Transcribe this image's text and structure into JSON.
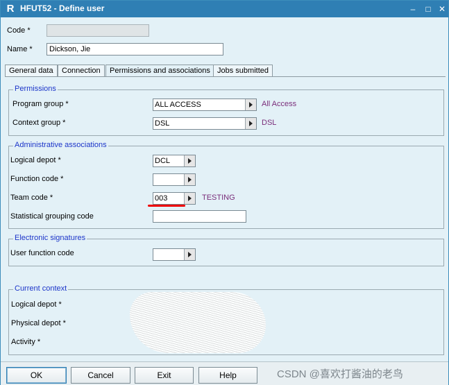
{
  "window": {
    "title": "HFUT52 - Define user",
    "logo": "R"
  },
  "window_controls": [
    "minimize-icon",
    "maximize-icon",
    "close-icon"
  ],
  "header": {
    "code_label": "Code *",
    "code_value": "",
    "name_label": "Name *",
    "name_value": "Dickson, Jie"
  },
  "tabs": [
    {
      "label": "General data"
    },
    {
      "label": "Connection"
    },
    {
      "label": "Permissions and associations"
    },
    {
      "label": "Jobs submitted"
    }
  ],
  "permissions": {
    "title": "Permissions",
    "program_group_label": "Program group *",
    "program_group_value": "ALL ACCESS",
    "program_group_desc": "All Access",
    "context_group_label": "Context group *",
    "context_group_value": "DSL",
    "context_group_desc": "DSL"
  },
  "admin": {
    "title": "Administrative associations",
    "logical_depot_label": "Logical depot *",
    "logical_depot_value": "DCL",
    "function_code_label": "Function code *",
    "function_code_value": "",
    "team_code_label": "Team code *",
    "team_code_value": "003",
    "team_code_desc": "TESTING",
    "stat_group_label": "Statistical grouping code",
    "stat_group_value": ""
  },
  "esign": {
    "title": "Electronic signatures",
    "user_function_label": "User function code",
    "user_function_value": ""
  },
  "context": {
    "title": "Current context",
    "logical_depot_label": "Logical depot *",
    "physical_depot_label": "Physical depot *",
    "activity_label": "Activity *"
  },
  "footer": {
    "ok": "OK",
    "cancel": "Cancel",
    "exit": "Exit",
    "help": "Help"
  },
  "watermark": "CSDN @喜欢打酱油的老鸟",
  "colors": {
    "titlebar": "#2f7fb4",
    "group_title": "#1c35c9",
    "description": "#7a2d7a",
    "highlight": "#e00000"
  }
}
